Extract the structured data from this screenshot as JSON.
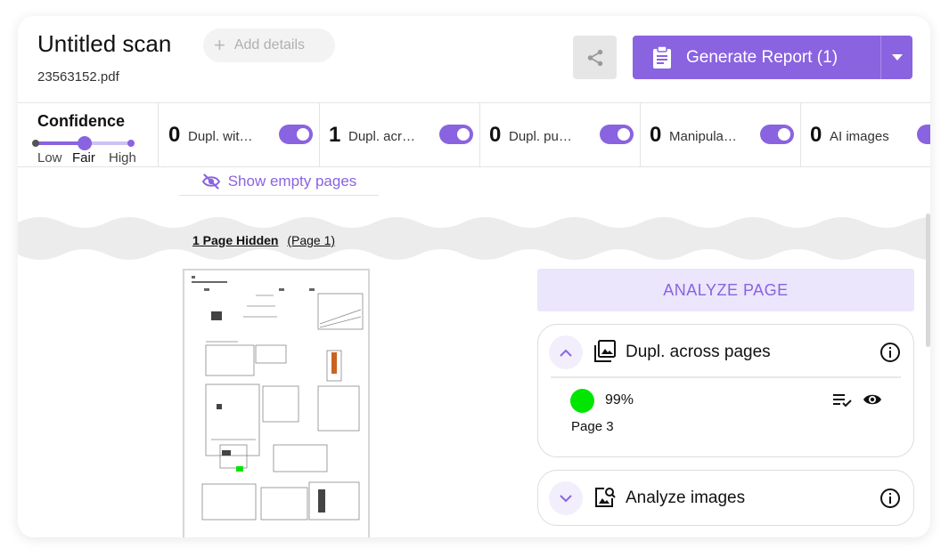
{
  "header": {
    "title": "Untitled scan",
    "add_details": "Add details",
    "filename": "23563152.pdf",
    "generate_report": "Generate Report (1)"
  },
  "confidence": {
    "title": "Confidence",
    "low": "Low",
    "fair": "Fair",
    "high": "High",
    "selected": "Fair"
  },
  "filters": [
    {
      "count": "0",
      "name": "Dupl. wit…"
    },
    {
      "count": "1",
      "name": "Dupl. acr…"
    },
    {
      "count": "0",
      "name": "Dupl. pu…"
    },
    {
      "count": "0",
      "name": "Manipula…"
    },
    {
      "count": "0",
      "name": "AI images"
    }
  ],
  "show_empty_pages": "Show empty pages",
  "hidden": {
    "label": "1 Page Hidden",
    "page": "(Page 1)"
  },
  "analyze_page": "ANALYZE PAGE",
  "panels": [
    {
      "title": "Dupl. across pages",
      "match_percent": "99%",
      "match_page": "Page 3"
    },
    {
      "title": "Analyze images"
    }
  ],
  "colors": {
    "accent": "#8a63e0",
    "accent_light": "#ebe6fb",
    "match": "#00e600"
  },
  "icons": [
    "plus-icon",
    "share-icon",
    "clipboard-icon",
    "chevron-down-icon",
    "eye-off-icon",
    "chevron-up-icon",
    "images-icon",
    "info-icon",
    "list-check-icon",
    "eye-icon",
    "image-search-icon"
  ]
}
